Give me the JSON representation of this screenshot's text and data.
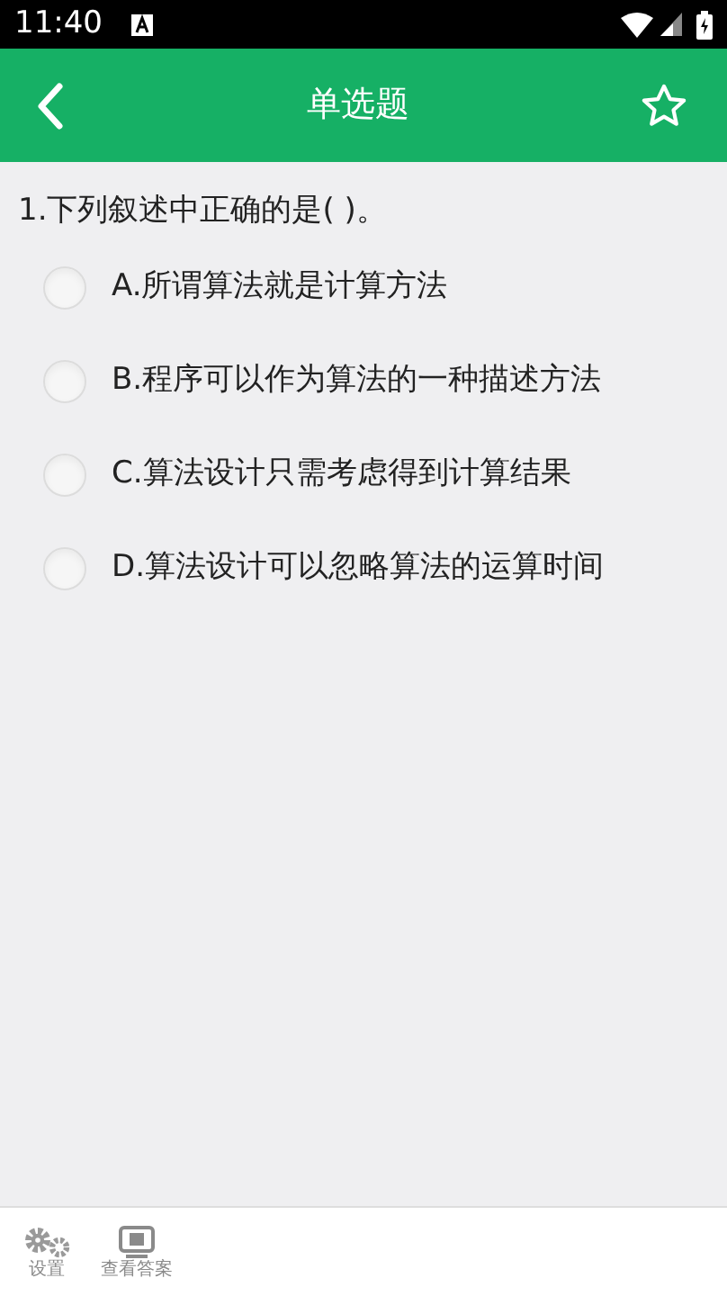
{
  "status_bar": {
    "time": "11:40"
  },
  "header": {
    "title": "单选题",
    "favorited": false
  },
  "question": {
    "text": "1.下列叙述中正确的是( )。",
    "options": [
      {
        "label": "A.所谓算法就是计算方法",
        "selected": false
      },
      {
        "label": "B.程序可以作为算法的一种描述方法",
        "selected": false
      },
      {
        "label": "C.算法设计只需考虑得到计算结果",
        "selected": false
      },
      {
        "label": "D.算法设计可以忽略算法的运算时间",
        "selected": false
      }
    ]
  },
  "bottom_bar": {
    "items": [
      {
        "kind": "settings",
        "label": "设置"
      },
      {
        "kind": "answer",
        "label": "查看答案"
      }
    ]
  }
}
